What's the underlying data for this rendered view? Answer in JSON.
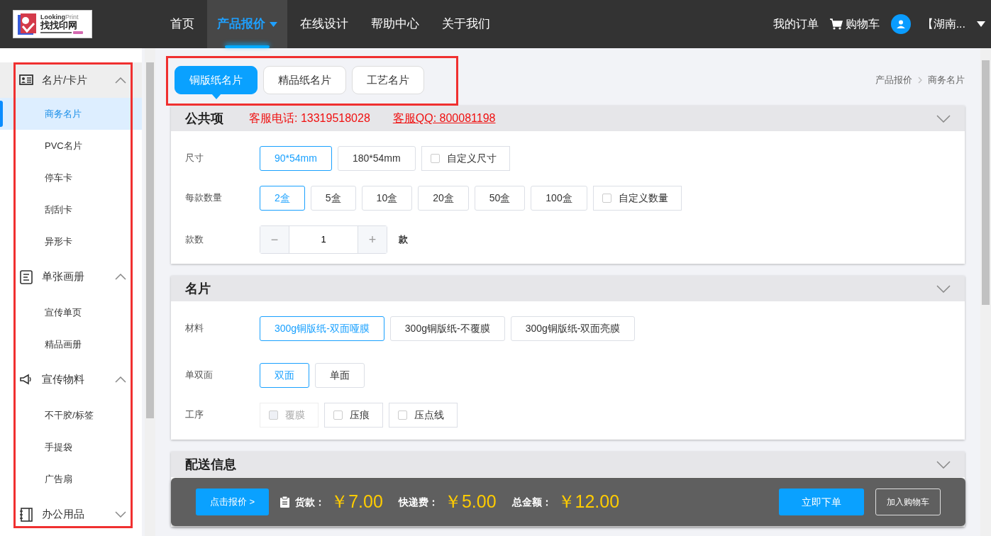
{
  "header": {
    "logo": {
      "word_1": "Looking",
      "word_2": "Print",
      "name": "找找印网"
    },
    "nav": [
      {
        "label": "首页",
        "selected": false,
        "has_caret": false
      },
      {
        "label": "产品报价",
        "selected": true,
        "has_caret": true
      },
      {
        "label": "在线设计",
        "selected": false,
        "has_caret": false
      },
      {
        "label": "帮助中心",
        "selected": false,
        "has_caret": false
      },
      {
        "label": "关于我们",
        "selected": false,
        "has_caret": false
      }
    ],
    "orders": "我的订单",
    "cart": "购物车",
    "user": "【湖南..."
  },
  "sidebar": {
    "highlighted": true,
    "groups": [
      {
        "label": "名片/卡片",
        "kind": "card",
        "expanded": true,
        "active": true,
        "children": [
          {
            "label": "商务名片",
            "selected": true
          },
          {
            "label": "PVC名片",
            "selected": false
          },
          {
            "label": "停车卡",
            "selected": false
          },
          {
            "label": "刮刮卡",
            "selected": false
          },
          {
            "label": "异形卡",
            "selected": false
          }
        ]
      },
      {
        "label": "单张画册",
        "kind": "doc",
        "expanded": true,
        "active": false,
        "children": [
          {
            "label": "宣传单页",
            "selected": false
          },
          {
            "label": "精品画册",
            "selected": false
          }
        ]
      },
      {
        "label": "宣传物料",
        "kind": "megaphone",
        "expanded": true,
        "active": false,
        "children": [
          {
            "label": "不干胶/标签",
            "selected": false
          },
          {
            "label": "手提袋",
            "selected": false
          },
          {
            "label": "广告扇",
            "selected": false
          }
        ]
      },
      {
        "label": "办公用品",
        "kind": "notebook",
        "expanded": false,
        "active": false
      }
    ]
  },
  "product_tabs": {
    "highlighted": true,
    "items": [
      {
        "label": "铜版纸名片",
        "selected": true
      },
      {
        "label": "精品纸名片",
        "selected": false
      },
      {
        "label": "工艺名片",
        "selected": false
      }
    ]
  },
  "breadcrumb": [
    "产品报价",
    "商务名片"
  ],
  "sections": [
    {
      "title": "公共项",
      "phone": "客服电话: 13319518028",
      "qq": "客服QQ: 800081198",
      "rows": [
        {
          "label": "尺寸",
          "kind": "options",
          "options": [
            {
              "label": "90*54mm",
              "kind": "chip",
              "selected": true
            },
            {
              "label": "180*54mm",
              "kind": "chip",
              "selected": false
            },
            {
              "label": "自定义尺寸",
              "kind": "checkbox",
              "checked": false,
              "disabled": false
            }
          ]
        },
        {
          "label": "每款数量",
          "kind": "options",
          "options": [
            {
              "label": "2盒",
              "kind": "chip",
              "selected": true
            },
            {
              "label": "5盒",
              "kind": "chip",
              "selected": false
            },
            {
              "label": "10盒",
              "kind": "chip",
              "selected": false
            },
            {
              "label": "20盒",
              "kind": "chip",
              "selected": false
            },
            {
              "label": "50盒",
              "kind": "chip",
              "selected": false
            },
            {
              "label": "100盒",
              "kind": "chip",
              "selected": false
            },
            {
              "label": "自定义数量",
              "kind": "checkbox",
              "checked": false,
              "disabled": false
            }
          ]
        },
        {
          "label": "款数",
          "kind": "stepper",
          "minus": "−",
          "value": "1",
          "plus": "+",
          "unit": "款"
        }
      ]
    },
    {
      "title": "名片",
      "rows": [
        {
          "label": "材料",
          "kind": "options",
          "options": [
            {
              "label": "300g铜版纸-双面哑膜",
              "kind": "chip",
              "selected": true
            },
            {
              "label": "300g铜版纸-不覆膜",
              "kind": "chip",
              "selected": false
            },
            {
              "label": "300g铜版纸-双面亮膜",
              "kind": "chip",
              "selected": false
            }
          ]
        },
        {
          "label": "单双面",
          "kind": "options",
          "options": [
            {
              "label": "双面",
              "kind": "chip",
              "selected": true
            },
            {
              "label": "单面",
              "kind": "chip",
              "selected": false
            }
          ]
        },
        {
          "label": "工序",
          "kind": "options",
          "options": [
            {
              "label": "覆膜",
              "kind": "checkbox",
              "checked": false,
              "disabled": true
            },
            {
              "label": "压痕",
              "kind": "checkbox",
              "checked": false,
              "disabled": false
            },
            {
              "label": "压点线",
              "kind": "checkbox",
              "checked": false,
              "disabled": false
            }
          ]
        }
      ]
    },
    {
      "title": "配送信息"
    }
  ],
  "price_bar": {
    "quote_button": "点击报价 >",
    "goods_label": "货款：",
    "goods": "￥7.00",
    "shipping_label": "快递费：",
    "shipping": "￥5.00",
    "total_label": "总金额：",
    "total": "￥12.00",
    "order_button": "立即下单",
    "cart_button": "加入购物车"
  }
}
